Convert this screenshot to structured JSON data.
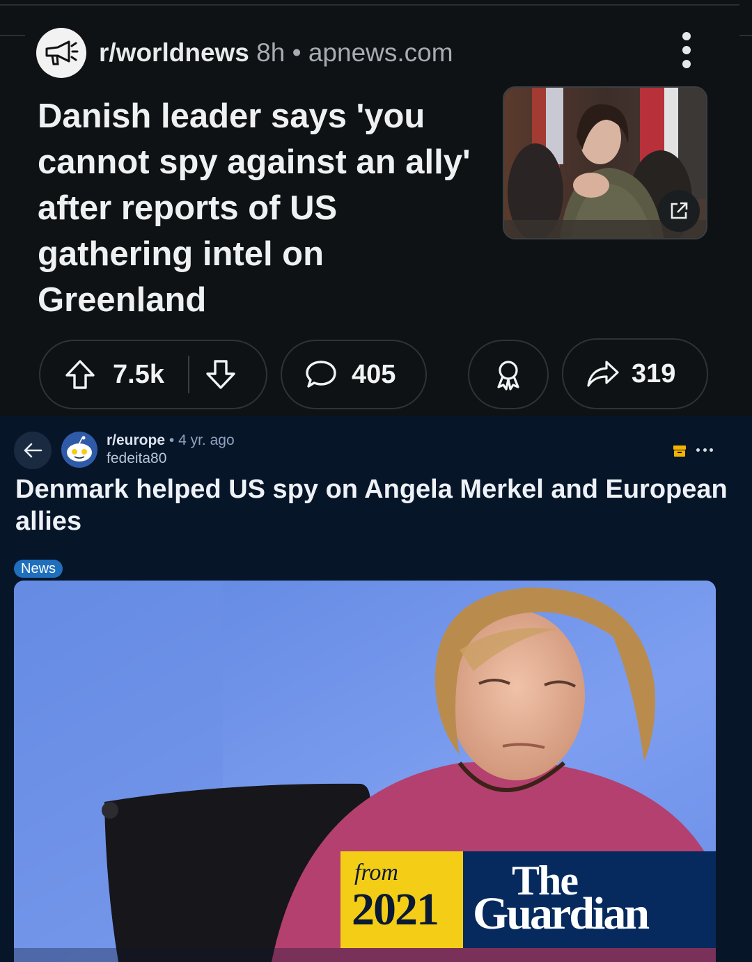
{
  "post1": {
    "subreddit": "r/worldnews",
    "age": "8h",
    "separator": "•",
    "domain": "apnews.com",
    "title": "Danish leader says 'you cannot spy against an ally' after reports of US gathering intel on Greenland",
    "votes": "7.5k",
    "comments": "405",
    "shares": "319"
  },
  "post2": {
    "subreddit": "r/europe",
    "separator": "•",
    "age": "4 yr. ago",
    "username": "fedeita80",
    "title": "Denmark helped US spy on Angela Merkel and European allies",
    "flair": "News",
    "badge_from": "from",
    "badge_year": "2021",
    "badge_the": "The",
    "badge_guardian": "Guardian"
  },
  "colors": {
    "post1_bg": "#0f1214",
    "post2_bg": "#071529",
    "flair": "#1f6fbd",
    "badge_yellow": "#f4cd16",
    "badge_navy": "#062a5e"
  },
  "icons": [
    "megaphone-icon",
    "kebab-menu-icon",
    "external-link-icon",
    "upvote-icon",
    "downvote-icon",
    "comment-icon",
    "award-icon",
    "share-icon",
    "back-arrow-icon",
    "archive-icon",
    "more-icon"
  ]
}
